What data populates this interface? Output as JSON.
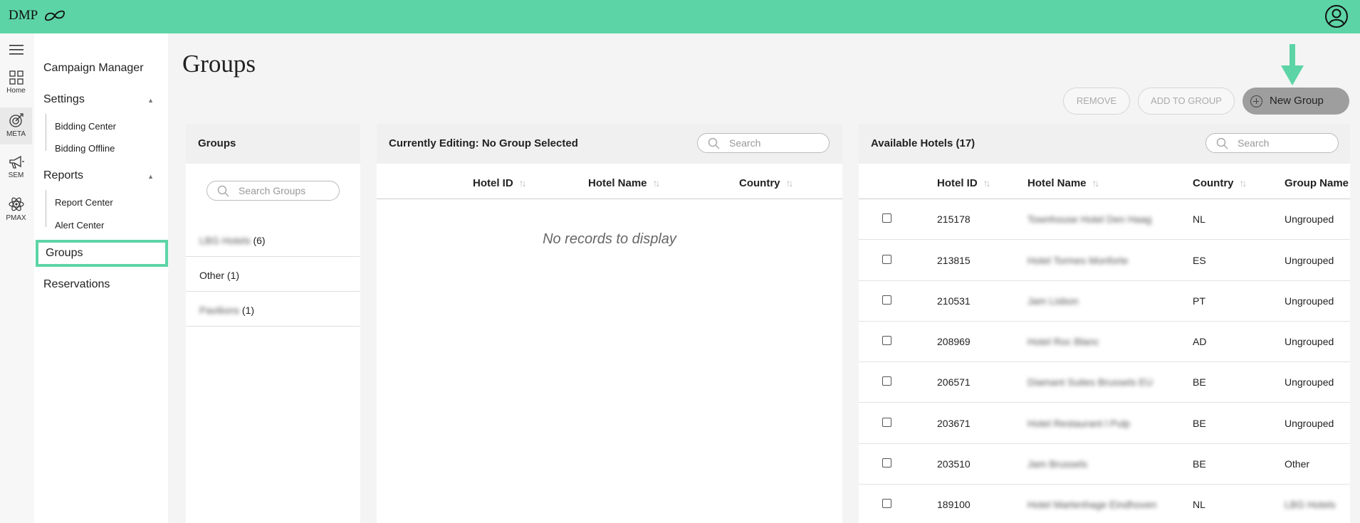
{
  "app": {
    "brand": "DMP"
  },
  "rail": {
    "items": [
      {
        "label": "Home",
        "icon": "grid-icon"
      },
      {
        "label": "META",
        "icon": "target-icon"
      },
      {
        "label": "SEM",
        "icon": "megaphone-icon"
      },
      {
        "label": "PMAX",
        "icon": "atom-icon"
      }
    ]
  },
  "sidenav": {
    "campaign_manager": "Campaign Manager",
    "settings": "Settings",
    "bidding_center": "Bidding Center",
    "bidding_offline": "Bidding Offline",
    "reports": "Reports",
    "report_center": "Report Center",
    "alert_center": "Alert Center",
    "groups": "Groups",
    "reservations": "Reservations"
  },
  "page": {
    "title": "Groups"
  },
  "actions": {
    "remove": "REMOVE",
    "add_to_group": "ADD TO GROUP",
    "new_group": "New Group"
  },
  "groups_panel": {
    "title": "Groups",
    "search_placeholder": "Search Groups",
    "items": [
      {
        "name": "LBG Hotels",
        "count": "(6)",
        "blurred": true
      },
      {
        "name": "Other",
        "count": "(1)",
        "blurred": false
      },
      {
        "name": "Pavilions",
        "count": "(1)",
        "blurred": true
      }
    ]
  },
  "editing_panel": {
    "title": "Currently Editing: No Group Selected",
    "search_placeholder": "Search",
    "columns": [
      "Hotel ID",
      "Hotel Name",
      "Country"
    ],
    "empty_text": "No records to display"
  },
  "available_panel": {
    "title": "Available Hotels (17)",
    "search_placeholder": "Search",
    "columns": [
      "Hotel ID",
      "Hotel Name",
      "Country",
      "Group Name"
    ],
    "rows": [
      {
        "id": "215178",
        "name": "Townhouse Hotel Den Haag",
        "country": "NL",
        "group": "Ungrouped"
      },
      {
        "id": "213815",
        "name": "Hotel Tormes Monforte",
        "country": "ES",
        "group": "Ungrouped"
      },
      {
        "id": "210531",
        "name": "Jam Lisbon",
        "country": "PT",
        "group": "Ungrouped"
      },
      {
        "id": "208969",
        "name": "Hotel Roc Blanc",
        "country": "AD",
        "group": "Ungrouped"
      },
      {
        "id": "206571",
        "name": "Diamant Suites Brussels EU",
        "country": "BE",
        "group": "Ungrouped"
      },
      {
        "id": "203671",
        "name": "Hotel Restaurant l Pulp",
        "country": "BE",
        "group": "Ungrouped"
      },
      {
        "id": "203510",
        "name": "Jam Brussels",
        "country": "BE",
        "group": "Other"
      },
      {
        "id": "189100",
        "name": "Hotel Martenhage Eindhoven",
        "country": "NL",
        "group": "LBG Hotels"
      }
    ]
  },
  "colors": {
    "accent": "#5dd4a6",
    "new_group_bg": "#9e9e9e"
  }
}
